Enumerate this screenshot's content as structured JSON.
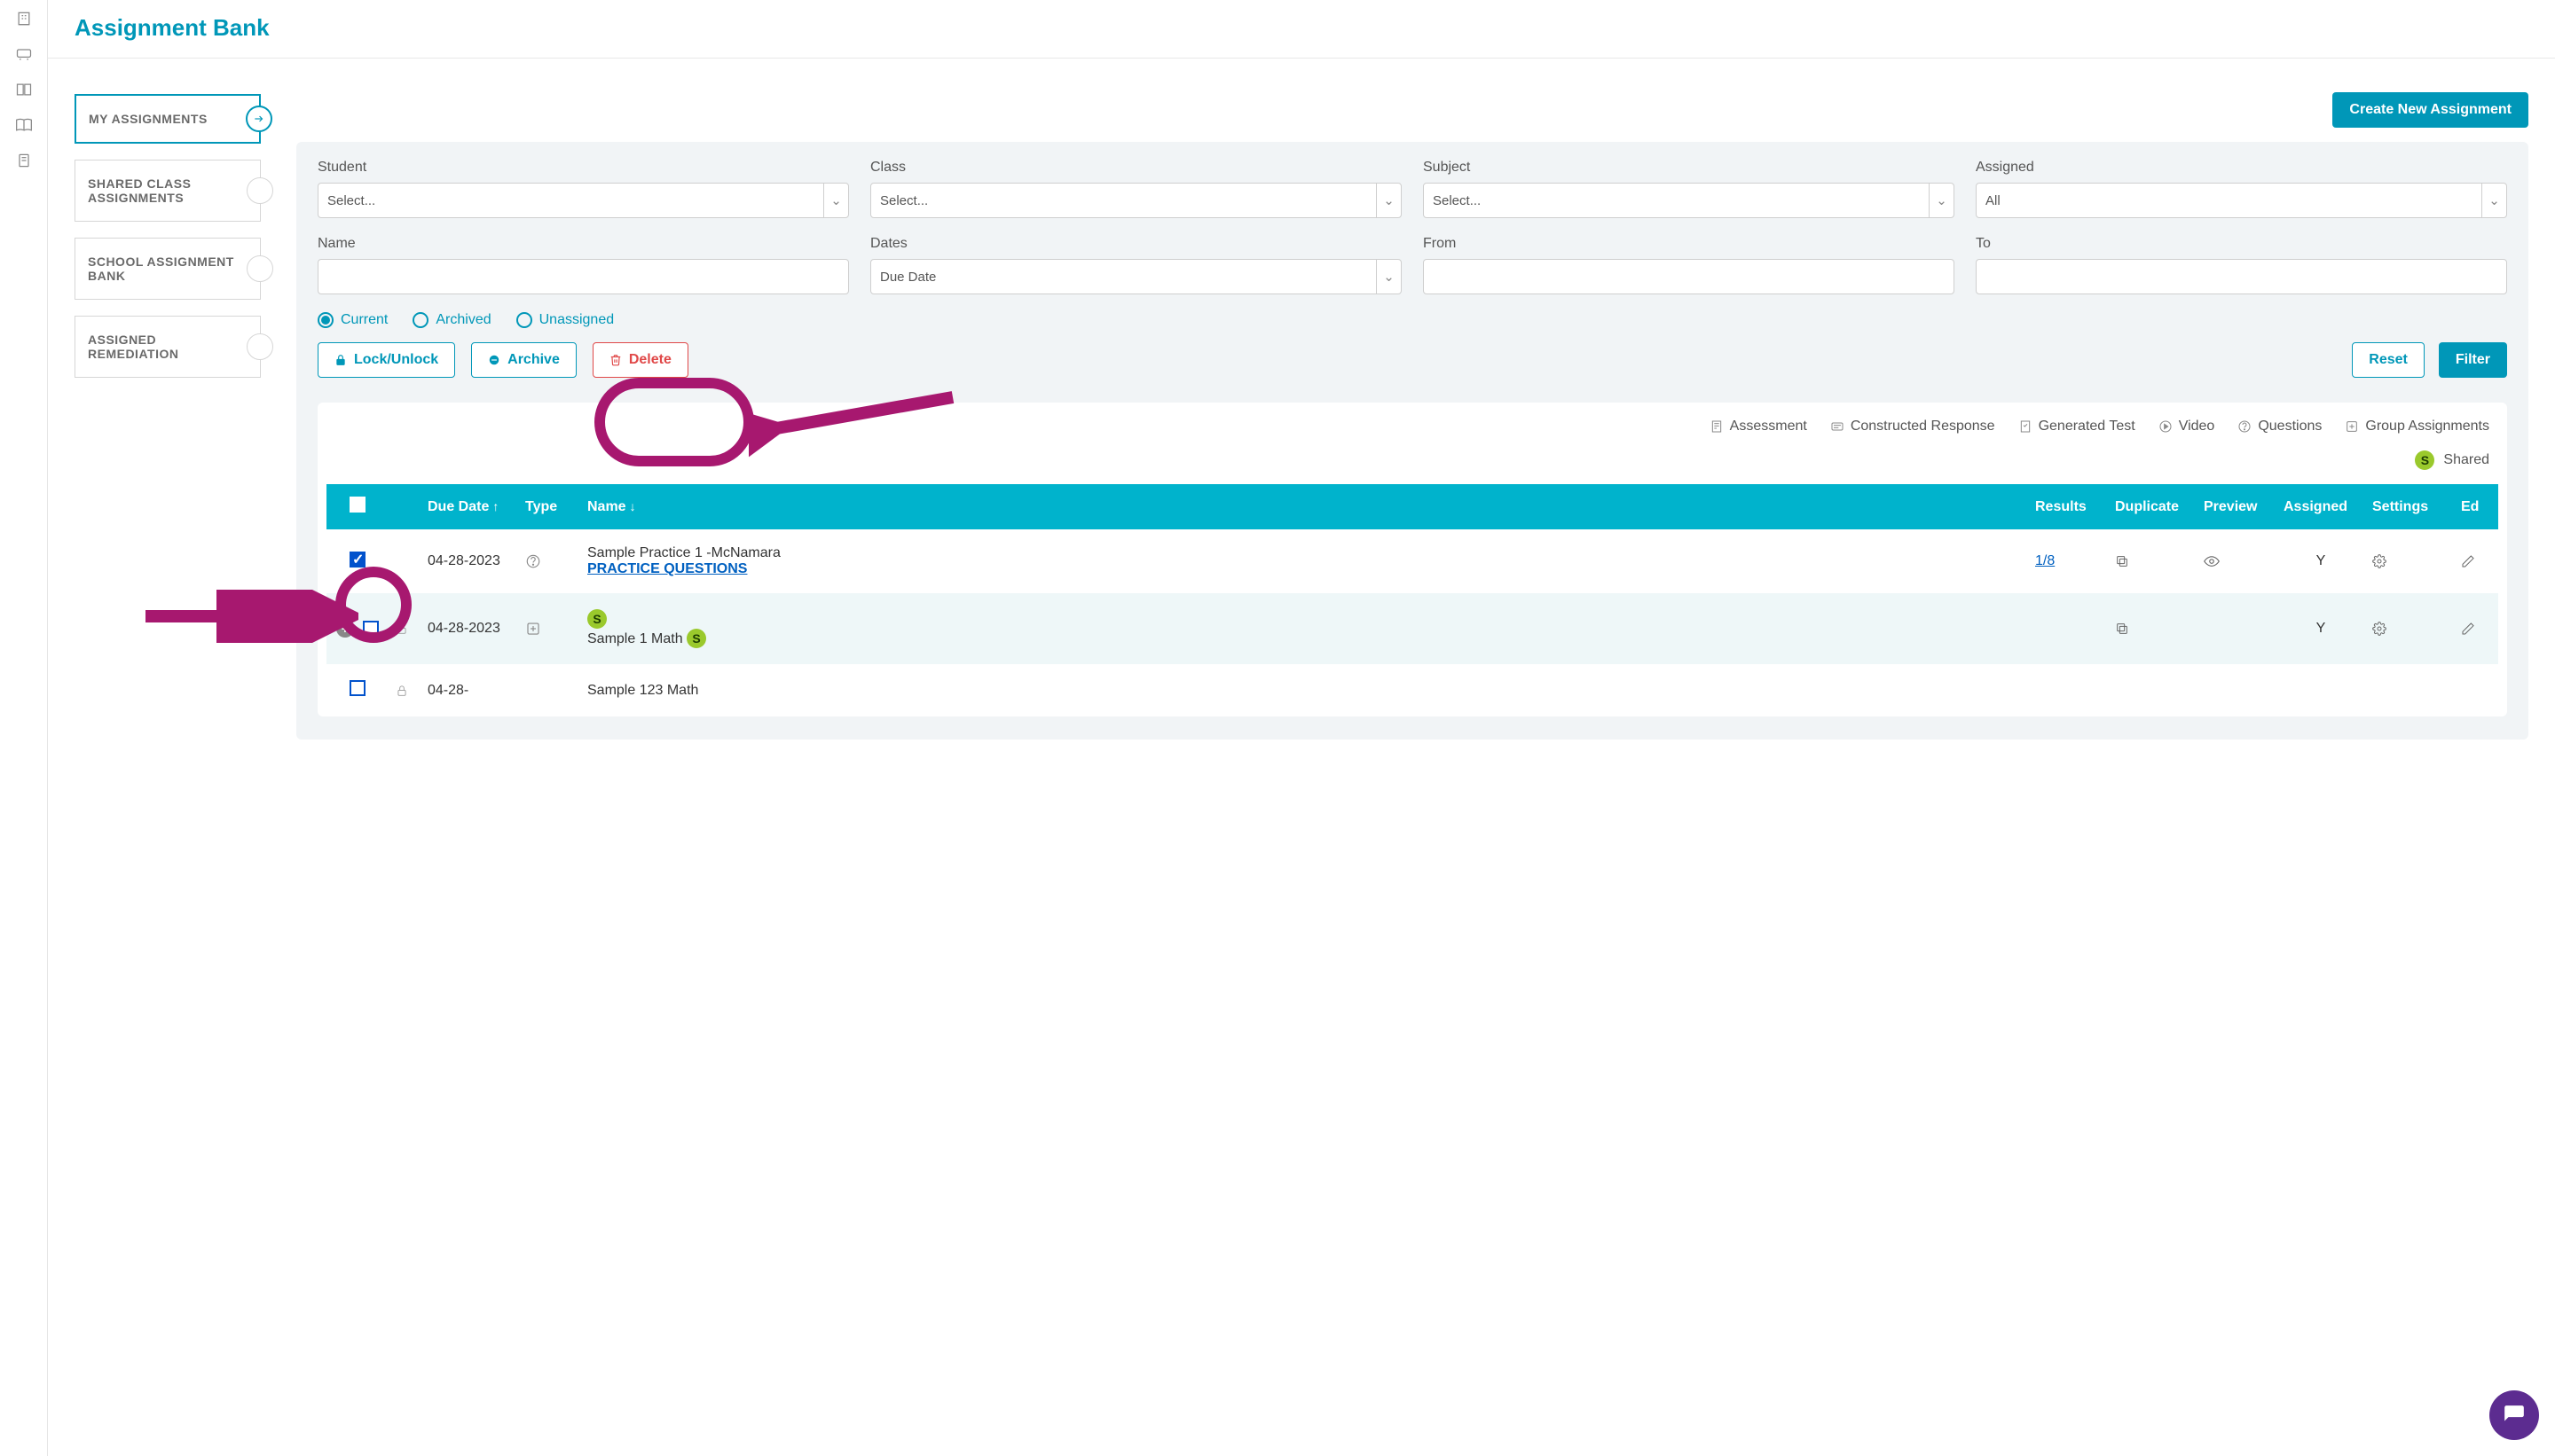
{
  "page_title": "Assignment Bank",
  "create_button": "Create New Assignment",
  "side_tabs": [
    {
      "label": "MY ASSIGNMENTS",
      "active": true
    },
    {
      "label": "SHARED CLASS ASSIGNMENTS",
      "active": false
    },
    {
      "label": "SCHOOL ASSIGNMENT BANK",
      "active": false
    },
    {
      "label": "ASSIGNED REMEDIATION",
      "active": false
    }
  ],
  "filters": {
    "student": {
      "label": "Student",
      "placeholder": "Select..."
    },
    "class": {
      "label": "Class",
      "placeholder": "Select..."
    },
    "subject": {
      "label": "Subject",
      "placeholder": "Select..."
    },
    "assigned": {
      "label": "Assigned",
      "value": "All"
    },
    "name": {
      "label": "Name",
      "value": ""
    },
    "dates": {
      "label": "Dates",
      "value": "Due Date"
    },
    "from": {
      "label": "From",
      "value": ""
    },
    "to": {
      "label": "To",
      "value": ""
    }
  },
  "radios": {
    "current": "Current",
    "archived": "Archived",
    "unassigned": "Unassigned",
    "selected": "current"
  },
  "actions": {
    "lock": "Lock/Unlock",
    "archive": "Archive",
    "delete": "Delete",
    "reset": "Reset",
    "filter": "Filter"
  },
  "legend": {
    "assessment": "Assessment",
    "constructed": "Constructed Response",
    "generated": "Generated Test",
    "video": "Video",
    "questions": "Questions",
    "group": "Group Assignments",
    "shared_label": "Shared",
    "shared_badge": "S"
  },
  "table": {
    "headers": {
      "due_date": "Due Date",
      "type": "Type",
      "name": "Name",
      "results": "Results",
      "duplicate": "Duplicate",
      "preview": "Preview",
      "assigned": "Assigned",
      "settings": "Settings",
      "edit": "Ed"
    },
    "rows": [
      {
        "checked": true,
        "due": "04-28-2023",
        "type_icon": "questions",
        "name": "Sample Practice 1 -McNamara",
        "name_sub": "PRACTICE QUESTIONS",
        "results": "1/8",
        "assigned": "Y",
        "shared_badge": false,
        "row_add": false,
        "preview": true,
        "edit": true
      },
      {
        "checked": false,
        "due": "04-28-2023",
        "type_icon": "group",
        "name": "Sample 1 Math",
        "name_sub": "",
        "results": "",
        "assigned": "Y",
        "shared_badge": true,
        "shared_inline": true,
        "row_add": true,
        "preview": false,
        "edit": true
      },
      {
        "checked": false,
        "due": "04-28-",
        "type_icon": "",
        "name": "Sample 123 Math",
        "name_sub": "",
        "results": "",
        "assigned": "",
        "shared_badge": false,
        "row_add": false,
        "preview": false,
        "edit": false
      }
    ]
  }
}
